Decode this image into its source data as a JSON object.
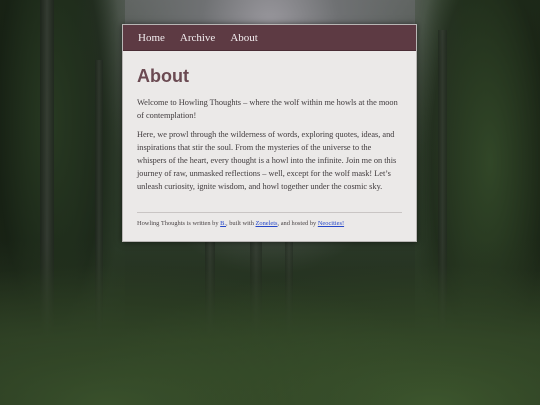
{
  "nav": {
    "items": [
      {
        "label": "Home"
      },
      {
        "label": "Archive"
      },
      {
        "label": "About"
      }
    ]
  },
  "page": {
    "title": "About",
    "paragraphs": [
      "Welcome to Howling Thoughts – where the wolf within me howls at the moon of contemplation!",
      "Here, we prowl through the wilderness of words, exploring quotes, ideas, and inspirations that stir the soul. From the mysteries of the universe to the whispers of the heart, every thought is a howl into the infinite. Join me on this journey of raw, unmasked reflections – well, except for the wolf mask! Let’s unleash curiosity, ignite wisdom, and howl together under the cosmic sky."
    ]
  },
  "footer": {
    "text_1": "Howling Thoughts is written by ",
    "author_link": "B.",
    "text_2": ", built with ",
    "builder_link": "Zonelets",
    "text_3": ", and hosted by ",
    "host_link": "Neocities!"
  },
  "colors": {
    "nav_bg": "#5d3a43",
    "title": "#6b4a52",
    "card_bg": "#ebe9e8",
    "link": "#2446c8"
  }
}
